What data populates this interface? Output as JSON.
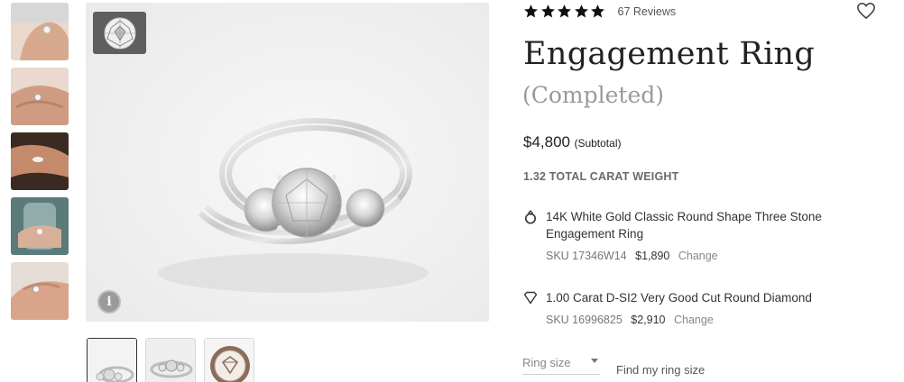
{
  "product": {
    "rating_stars": 5,
    "reviews_text": "67 Reviews",
    "title": "Engagement Ring",
    "subtitle": "(Completed)",
    "price": "$4,800",
    "price_note": "(Subtotal)",
    "carat_weight": "1.32 TOTAL CARAT WEIGHT"
  },
  "components": [
    {
      "icon": "ring-icon",
      "name": "14K White Gold Classic Round Shape Three Stone Engagement Ring",
      "sku": "SKU 17346W14",
      "price": "$1,890",
      "change_label": "Change"
    },
    {
      "icon": "diamond-icon",
      "name": "1.00 Carat D-SI2 Very Good Cut Round Diamond",
      "sku": "SKU 16996825",
      "price": "$2,910",
      "change_label": "Change"
    }
  ],
  "ring_size": {
    "placeholder": "Ring size",
    "link": "Find my ring size"
  },
  "colors": {
    "star": "#111111",
    "image_bg": "#efefef",
    "badge_bg": "#5f5f5f"
  }
}
